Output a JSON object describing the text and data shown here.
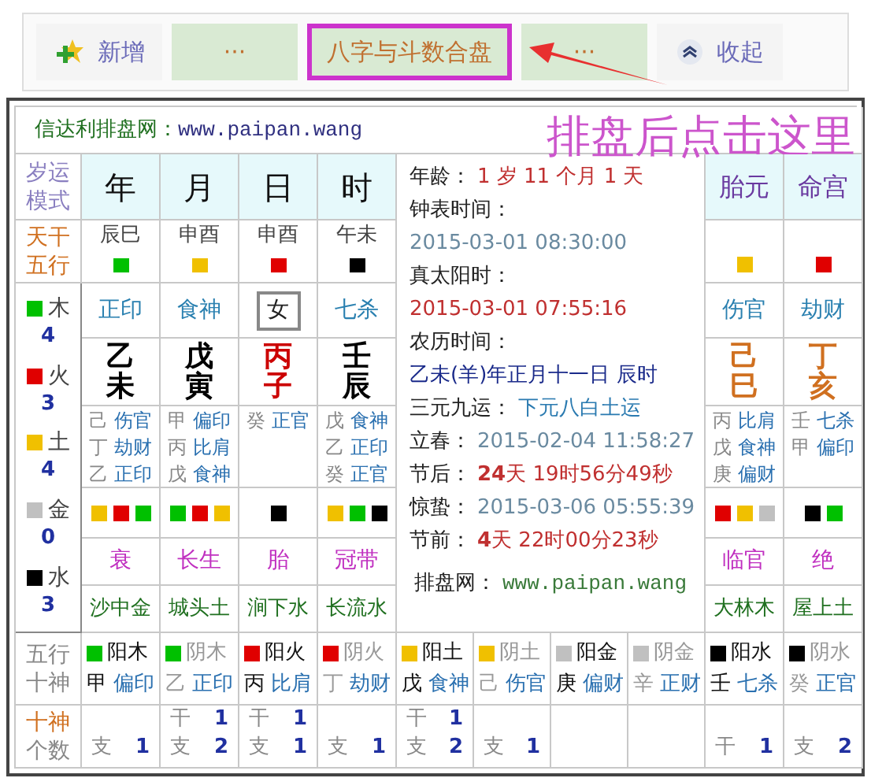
{
  "tabs": [
    {
      "label": "新增",
      "kind": "add",
      "selected": false
    },
    {
      "label": "···",
      "kind": "plain",
      "selected": false
    },
    {
      "label": "八字与斗数合盘",
      "kind": "plain",
      "selected": true
    },
    {
      "label": "···",
      "kind": "plain",
      "selected": false
    },
    {
      "label": "收起",
      "kind": "collapse",
      "selected": false
    }
  ],
  "annotation": {
    "text": "排盘后点击这里"
  },
  "site": {
    "name": "信达利排盘网：",
    "url": "www.paipan.wang"
  },
  "labels": {
    "mode": [
      "岁运",
      "模式"
    ],
    "stem_elements": [
      "天干",
      "五行"
    ],
    "element_gods": [
      "五行",
      "十神"
    ],
    "god_counts": [
      "十神",
      "个数"
    ]
  },
  "pillars": [
    {
      "heading": "年",
      "void": "辰巳",
      "element": {
        "color": "#00c000"
      },
      "god": {
        "text": "正印",
        "kind": "text"
      },
      "stem": "乙",
      "branch": "未",
      "color": "#000000",
      "hidden": [
        {
          "stem": "己",
          "god": "伤官"
        },
        {
          "stem": "丁",
          "god": "劫财"
        },
        {
          "stem": "乙",
          "god": "正印"
        }
      ],
      "dots": [
        {
          "color": "#f0c000"
        },
        {
          "color": "#e00000"
        },
        {
          "color": "#00c000"
        }
      ],
      "stage": "衰",
      "nayin": "沙中金"
    },
    {
      "heading": "月",
      "void": "申酉",
      "element": {
        "color": "#f0c000"
      },
      "god": {
        "text": "食神",
        "kind": "text"
      },
      "stem": "戊",
      "branch": "寅",
      "color": "#000000",
      "hidden": [
        {
          "stem": "甲",
          "god": "偏印"
        },
        {
          "stem": "丙",
          "god": "比肩"
        },
        {
          "stem": "戊",
          "god": "食神"
        }
      ],
      "dots": [
        {
          "color": "#00c000"
        },
        {
          "color": "#e00000"
        },
        {
          "color": "#f0c000"
        }
      ],
      "stage": "长生",
      "nayin": "城头土"
    },
    {
      "heading": "日",
      "void": "申酉",
      "element": {
        "color": "#e00000"
      },
      "god": {
        "text": "女",
        "kind": "gender"
      },
      "stem": "丙",
      "branch": "子",
      "color": "#cc0000",
      "hidden": [
        {
          "stem": "癸",
          "god": "正官"
        }
      ],
      "dots": [
        {
          "color": "#000000"
        }
      ],
      "stage": "胎",
      "nayin": "涧下水"
    },
    {
      "heading": "时",
      "void": "午未",
      "element": {
        "color": "#000000"
      },
      "god": {
        "text": "七杀",
        "kind": "text"
      },
      "stem": "壬",
      "branch": "辰",
      "color": "#000000",
      "hidden": [
        {
          "stem": "戊",
          "god": "食神"
        },
        {
          "stem": "乙",
          "god": "正印"
        },
        {
          "stem": "癸",
          "god": "正官"
        }
      ],
      "dots": [
        {
          "color": "#f0c000"
        },
        {
          "color": "#00c000"
        },
        {
          "color": "#000000"
        }
      ],
      "stage": "冠带",
      "nayin": "长流水"
    },
    {
      "heading": "胎元",
      "element": {
        "color": "#f0c000"
      },
      "god": {
        "text": "伤官",
        "kind": "text"
      },
      "stem": "己",
      "branch": "巳",
      "color": "#d07020",
      "hidden": [
        {
          "stem": "丙",
          "god": "比肩"
        },
        {
          "stem": "戊",
          "god": "食神"
        },
        {
          "stem": "庚",
          "god": "偏财"
        }
      ],
      "dots": [
        {
          "color": "#e00000"
        },
        {
          "color": "#f0c000"
        },
        {
          "color": "#c0c0c0"
        }
      ],
      "stage": "临官",
      "nayin": "大林木"
    },
    {
      "heading": "命宫",
      "element": {
        "color": "#e00000"
      },
      "god": {
        "text": "劫财",
        "kind": "text"
      },
      "stem": "丁",
      "branch": "亥",
      "color": "#d07020",
      "hidden": [
        {
          "stem": "壬",
          "god": "七杀"
        },
        {
          "stem": "甲",
          "god": "偏印"
        }
      ],
      "dots": [
        {
          "color": "#000000"
        },
        {
          "color": "#00c000"
        }
      ],
      "stage": "绝",
      "nayin": "屋上土"
    }
  ],
  "element_counts": [
    {
      "name": "木",
      "count": "4",
      "color": "#00c000"
    },
    {
      "name": "火",
      "count": "3",
      "color": "#e00000"
    },
    {
      "name": "土",
      "count": "4",
      "color": "#f0c000"
    },
    {
      "name": "金",
      "count": "0",
      "color": "#c0c0c0"
    },
    {
      "name": "水",
      "count": "3",
      "color": "#000000"
    }
  ],
  "info": [
    {
      "label": "年龄：",
      "value": "1 岁 11 个月 1 天",
      "kind": "inline"
    },
    {
      "label": "钟表时间：",
      "value": "2015-03-01 08:30:00",
      "kind": "stacked"
    },
    {
      "label": "真太阳时：",
      "value": "2015-03-01 07:55:16",
      "kind": "stacked"
    },
    {
      "label": "农历时间：",
      "value": "乙未(羊)年正月十一日 辰时",
      "kind": "stacked"
    },
    {
      "label": "三元九运：",
      "value": "下元八白土运",
      "kind": "inline"
    },
    {
      "label": "立春：",
      "value": "2015-02-04 11:58:27",
      "kind": "inline"
    },
    {
      "label": "节后：",
      "value": "**24**天 19时56分49秒",
      "kind": "inline"
    },
    {
      "label": "惊蛰：",
      "value": "2015-03-06 05:55:39",
      "kind": "inline"
    },
    {
      "label": "节前：",
      "value": "**4**天 22时00分23秒",
      "kind": "inline"
    },
    {
      "label": "排盘网：",
      "value": "www.paipan.wang",
      "kind": "centered"
    }
  ],
  "element_gods": [
    {
      "element": "阳木",
      "kind": "yang",
      "color": "#00c000",
      "stem": "甲",
      "god": "偏印",
      "counts": [
        {
          "label": "支",
          "count": "1"
        }
      ]
    },
    {
      "element": "阴木",
      "kind": "yin",
      "color": "#00c000",
      "stem": "乙",
      "god": "正印",
      "counts": [
        {
          "label": "干",
          "count": "1"
        },
        {
          "label": "支",
          "count": "2"
        }
      ]
    },
    {
      "element": "阳火",
      "kind": "yang",
      "color": "#e00000",
      "stem": "丙",
      "god": "比肩",
      "counts": [
        {
          "label": "干",
          "count": "1"
        },
        {
          "label": "支",
          "count": "1"
        }
      ]
    },
    {
      "element": "阴火",
      "kind": "yin",
      "color": "#e00000",
      "stem": "丁",
      "god": "劫财",
      "counts": [
        {
          "label": "支",
          "count": "1"
        }
      ]
    },
    {
      "element": "阳土",
      "kind": "yang",
      "color": "#f0c000",
      "stem": "戊",
      "god": "食神",
      "counts": [
        {
          "label": "干",
          "count": "1"
        },
        {
          "label": "支",
          "count": "2"
        }
      ]
    },
    {
      "element": "阴土",
      "kind": "yin",
      "color": "#f0c000",
      "stem": "己",
      "god": "伤官",
      "counts": [
        {
          "label": "支",
          "count": "1"
        }
      ]
    },
    {
      "element": "阳金",
      "kind": "yang",
      "color": "#c0c0c0",
      "stem": "庚",
      "god": "偏财"
    },
    {
      "element": "阴金",
      "kind": "yin",
      "color": "#c0c0c0",
      "stem": "辛",
      "god": "正财"
    },
    {
      "element": "阳水",
      "kind": "yang",
      "color": "#000000",
      "stem": "壬",
      "god": "七杀",
      "counts": [
        {
          "label": "干",
          "count": "1"
        }
      ]
    },
    {
      "element": "阴水",
      "kind": "yin",
      "color": "#000000",
      "stem": "癸",
      "god": "正官",
      "counts": [
        {
          "label": "支",
          "count": "2"
        }
      ]
    }
  ]
}
